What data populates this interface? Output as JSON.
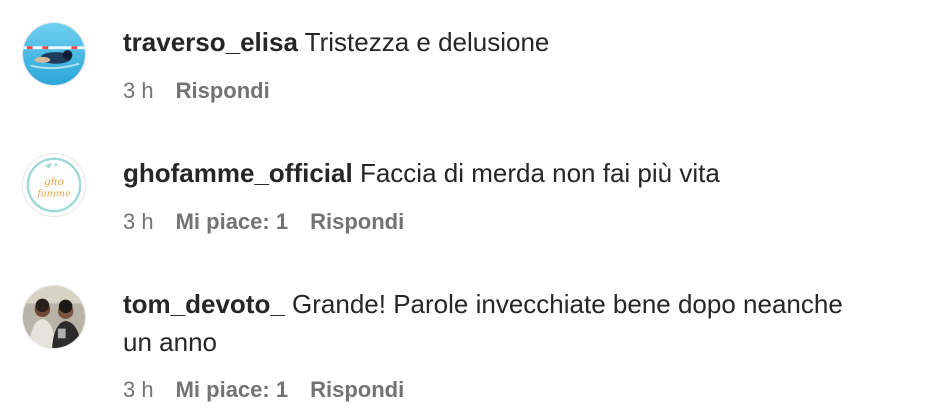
{
  "comments": [
    {
      "username": "traverso_elisa",
      "text": "Tristezza e delusione",
      "time": "3 h",
      "likes": "",
      "reply_label": "Rispondi",
      "avatar_icon": "swimmer-photo-avatar"
    },
    {
      "username": "ghofamme_official",
      "text": "Faccia di merda non fai più vita",
      "time": "3 h",
      "likes": "Mi piace: 1",
      "reply_label": "Rispondi",
      "avatar_icon": "ghofamme-logo-avatar",
      "avatar_logo_text": "gho famme"
    },
    {
      "username": "tom_devoto_",
      "text": "Grande! Parole invecchiate bene dopo neanche un anno",
      "time": "3 h",
      "likes": "Mi piace: 1",
      "reply_label": "Rispondi",
      "avatar_icon": "group-photo-avatar"
    }
  ],
  "colors": {
    "text_primary": "#262626",
    "text_secondary": "#737373",
    "background": "#ffffff"
  }
}
